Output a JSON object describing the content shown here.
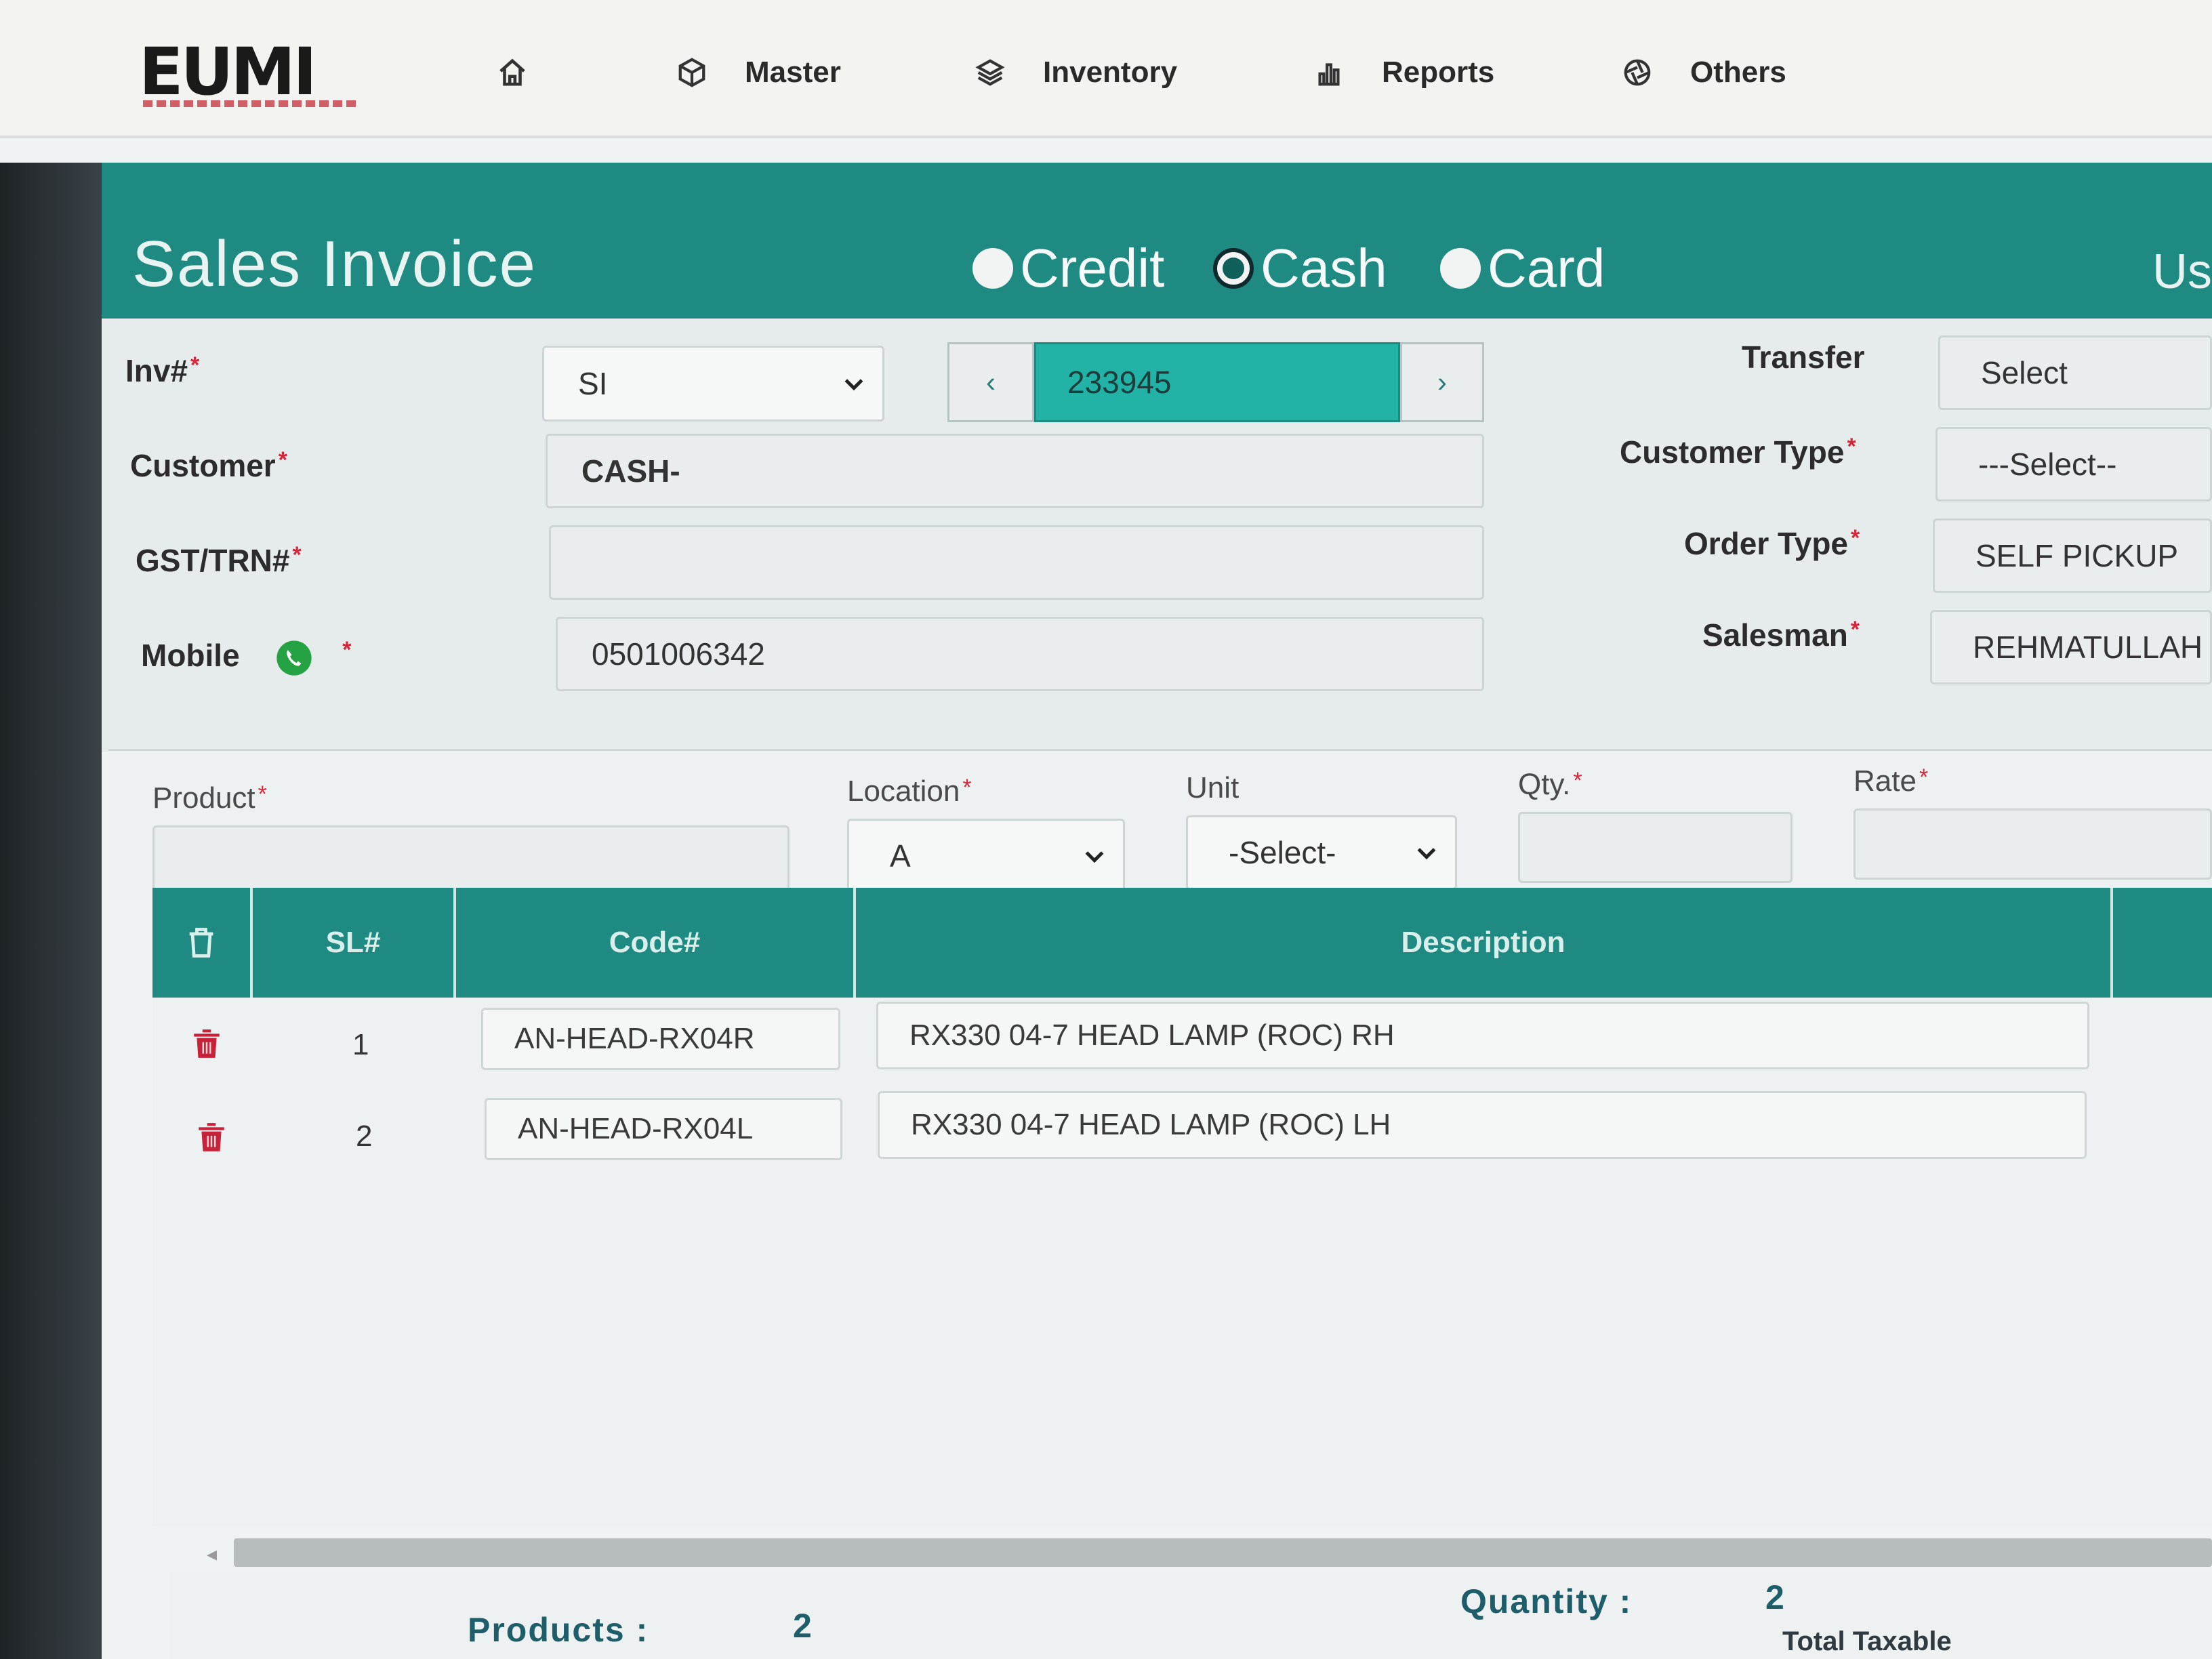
{
  "brand": {
    "logo_text": "EUMI"
  },
  "nav": {
    "home_icon": "home-icon",
    "items": [
      {
        "label": "Master",
        "icon": "cube-icon"
      },
      {
        "label": "Inventory",
        "icon": "layers-icon"
      },
      {
        "label": "Reports",
        "icon": "bar-chart-icon"
      },
      {
        "label": "Others",
        "icon": "aperture-icon"
      }
    ]
  },
  "page": {
    "title": "Sales Invoice",
    "header_right_partial": "Us",
    "payment_types": [
      {
        "label": "Credit",
        "checked": false
      },
      {
        "label": "Cash",
        "checked": true
      },
      {
        "label": "Card",
        "checked": false
      }
    ]
  },
  "form": {
    "inv_label": "Inv#",
    "inv_prefix": "SI",
    "inv_number": "233945",
    "prev_symbol": "‹",
    "next_symbol": "›",
    "customer_label": "Customer",
    "customer_value": "CASH-",
    "gst_label": "GST/TRN#",
    "gst_value": "",
    "mobile_label": "Mobile",
    "mobile_value": "0501006342",
    "required_mark": "*",
    "transfer_label": "Transfer",
    "transfer_value": "Select",
    "customer_type_label": "Customer Type",
    "customer_type_value": "---Select--",
    "order_type_label": "Order Type",
    "order_type_value": "SELF PICKUP",
    "salesman_label": "Salesman",
    "salesman_value": "REHMATULLAH"
  },
  "entry": {
    "product_label": "Product",
    "product_value": "",
    "location_label": "Location",
    "location_value": "A",
    "unit_label": "Unit",
    "unit_value": "-Select-",
    "qty_label": "Qty.",
    "qty_value": "",
    "rate_label": "Rate",
    "rate_value": ""
  },
  "table": {
    "headers": {
      "sl": "SL#",
      "code": "Code#",
      "description": "Description"
    },
    "rows": [
      {
        "sl": "1",
        "code": "AN-HEAD-RX04R",
        "description": "RX330 04-7 HEAD LAMP (ROC) RH"
      },
      {
        "sl": "2",
        "code": "AN-HEAD-RX04L",
        "description": "RX330 04-7 HEAD LAMP (ROC) LH"
      }
    ]
  },
  "summary": {
    "products_label": "Products :",
    "products_value": "2",
    "quantity_label": "Quantity :",
    "quantity_value": "2",
    "total_taxable_label": "Total Taxable"
  },
  "colors": {
    "teal": "#1f8a82",
    "teal_highlight": "#22b3a6",
    "required": "#d6263a",
    "delete": "#c8213a",
    "whatsapp": "#25a244"
  }
}
